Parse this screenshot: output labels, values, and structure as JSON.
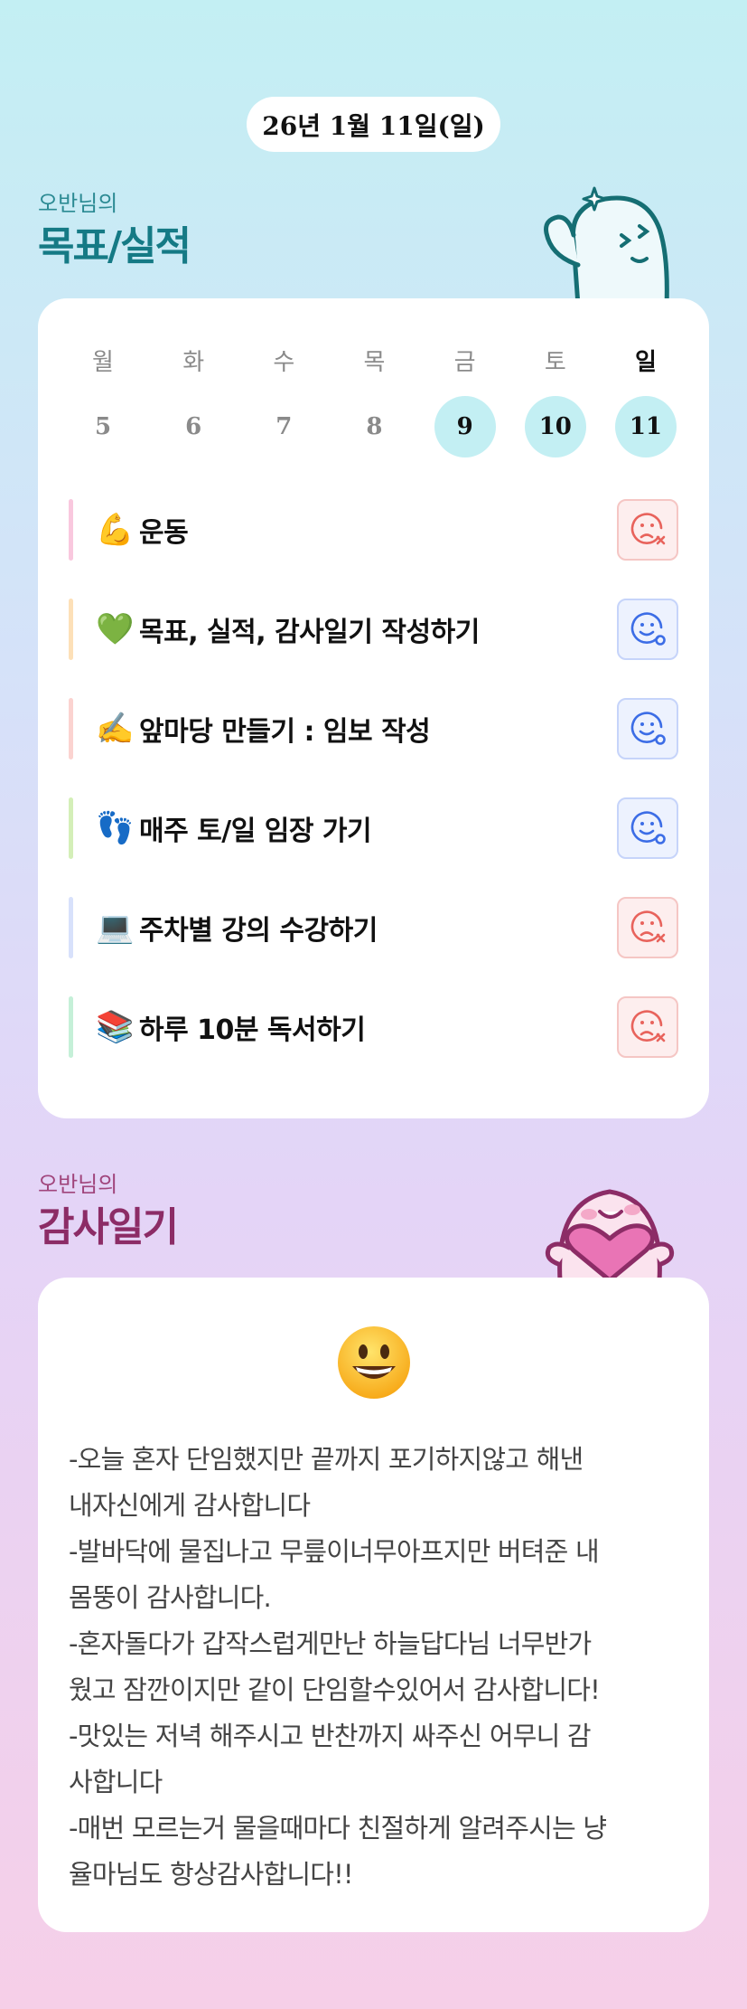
{
  "date": "26년 1월 11일(일)",
  "goals_section": {
    "owner": "오반님의",
    "title": "목표/실적",
    "weekdays": [
      "월",
      "화",
      "수",
      "목",
      "금",
      "토",
      "일"
    ],
    "dates": [
      "5",
      "6",
      "7",
      "8",
      "9",
      "10",
      "11"
    ],
    "completed_dates": [
      "9",
      "10",
      "11"
    ],
    "today": "일",
    "goals": [
      {
        "emoji": "💪",
        "label": "운동",
        "bar_color": "#f9c8de",
        "status": "fail",
        "status_icon": "sad-face-x-icon"
      },
      {
        "emoji": "💚",
        "label": "목표, 실적, 감사일기 작성하기",
        "bar_color": "#fde0b8",
        "status": "ok",
        "status_icon": "smile-face-check-icon"
      },
      {
        "emoji": "✍️",
        "label": "앞마당 만들기 : 임보 작성",
        "bar_color": "#fbd3d0",
        "status": "ok",
        "status_icon": "smile-face-check-icon"
      },
      {
        "emoji": "👣",
        "label": "매주 토/일 임장 가기",
        "bar_color": "#d4efb8",
        "status": "ok",
        "status_icon": "smile-face-check-icon"
      },
      {
        "emoji": "💻",
        "label": "주차별 강의 수강하기",
        "bar_color": "#d8e1fb",
        "status": "fail",
        "status_icon": "sad-face-x-icon"
      },
      {
        "emoji": "📚",
        "label": "하루 10분 독서하기",
        "bar_color": "#c5f0d8",
        "status": "fail",
        "status_icon": "sad-face-x-icon"
      }
    ]
  },
  "diary_section": {
    "owner": "오반님의",
    "title": "감사일기",
    "mood_icon": "grinning-face-icon",
    "lines": [
      "-오늘 혼자 단임했지만 끝까지 포기하지않고 해낸",
      "내자신에게 감사합니다",
      "-발바닥에 물집나고 무릎이너무아프지만 버텨준 내",
      "몸뚱이 감사합니다.",
      "-혼자돌다가 갑작스럽게만난 하늘답다님 너무반가",
      "웠고 잠깐이지만 같이 단임할수있어서 감사합니다!",
      "-맛있는 저녁 해주시고 반찬까지 싸주신 어무니 감",
      "사합니다",
      "-매번 모르는거 물을때마다 친절하게 알려주시는 냥",
      "율마님도 항상감사합니다!!"
    ]
  },
  "colors": {
    "completed_circle": "#c3eff3",
    "fail_icon": "#e8635c",
    "ok_icon": "#3c6de6",
    "goals_title": "#157a85",
    "diary_title": "#8c2c66"
  }
}
